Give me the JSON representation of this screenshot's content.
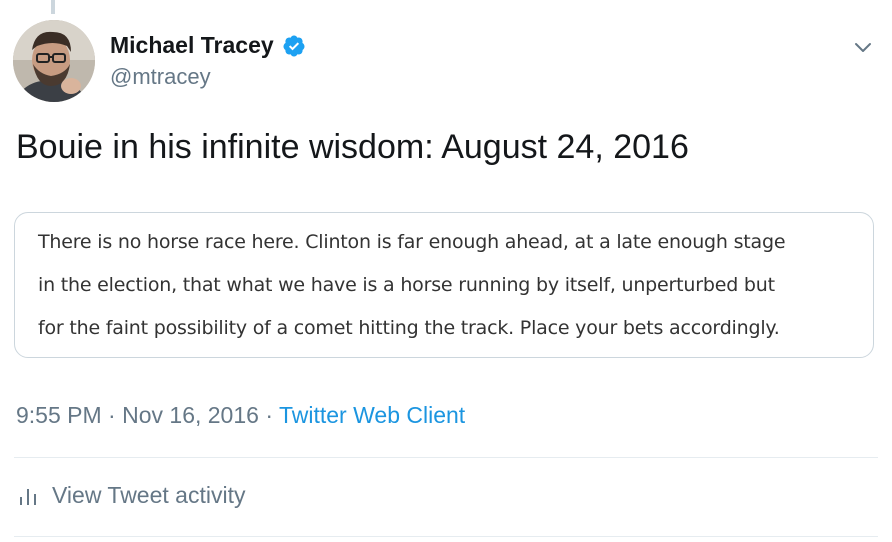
{
  "author": {
    "display_name": "Michael Tracey",
    "handle": "@mtracey",
    "verified": true,
    "avatar_icon": "avatar-image",
    "verified_icon": "verified-badge-icon"
  },
  "tweet": {
    "text": "Bouie in his infinite wisdom: August 24, 2016",
    "quote_lines": [
      "There is no horse race here. Clinton is far enough ahead, at a late enough stage",
      "in the election, that what we have is a horse running by itself, unperturbed but",
      "for the faint possibility of a comet hitting the track. Place your bets accordingly."
    ],
    "time": "9:55 PM",
    "date": "Nov 16, 2016",
    "separator": "·",
    "source": "Twitter Web Client"
  },
  "actions": {
    "menu_icon": "chevron-down-icon",
    "activity_label": "View Tweet activity",
    "activity_icon": "bar-chart-icon"
  },
  "colors": {
    "text_primary": "#14171a",
    "text_secondary": "#657786",
    "accent": "#1b95e0",
    "verified": "#1da1f2",
    "border": "#ccd6dd"
  }
}
